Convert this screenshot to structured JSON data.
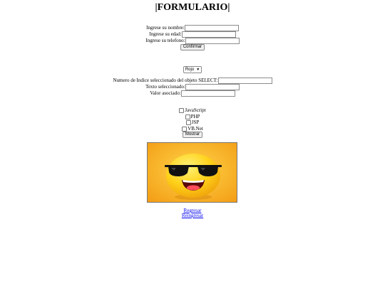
{
  "title": "|FORMULARIO|",
  "form": {
    "name_label": "Ingrese su nombre:",
    "age_label": "Ingrese su edad:",
    "phone_label": "Ingrese su telefono:",
    "name_value": "",
    "age_value": "",
    "phone_value": "",
    "submit_label": "Confirmar"
  },
  "select": {
    "selected": "Rojo",
    "index_label": "Numero de Indice seleccionado del objeto SELECT:",
    "text_label": "Texto seleccionado:",
    "value_label": "Valor asociado:",
    "index_value": "",
    "text_value": "",
    "value_value": ""
  },
  "checkboxes": {
    "items": [
      "JavaScript",
      "PHP",
      "JSP",
      "VB.Net"
    ],
    "button_label": "Mostrar"
  },
  "image": {
    "icon": "sunglasses-emoji-icon",
    "background": "#f7a21a"
  },
  "links": {
    "regresar": "Regresar",
    "reingresar": "Reingresar"
  }
}
